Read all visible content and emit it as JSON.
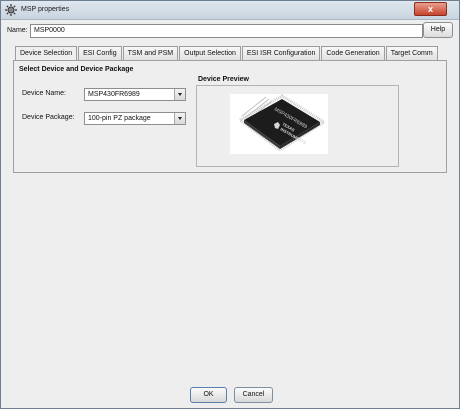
{
  "window": {
    "title": "MSP properties",
    "close_label": "x"
  },
  "name_row": {
    "label": "Name:",
    "value": "MSP0000",
    "help_label": "Help"
  },
  "tabs": [
    {
      "label": "Device Selection",
      "active": true
    },
    {
      "label": "ESI Config"
    },
    {
      "label": "TSM and PSM"
    },
    {
      "label": "Output Selection"
    },
    {
      "label": "ESI ISR Configuration"
    },
    {
      "label": "Code Generation"
    },
    {
      "label": "Target Comm"
    }
  ],
  "device_selection": {
    "section_title": "Select Device and Device Package",
    "device_name_label": "Device Name:",
    "device_name_value": "MSP430FR6989",
    "device_package_label": "Device Package:",
    "device_package_value": "100-pin PZ package",
    "preview_title": "Device Preview",
    "chip_marking": "MSP430FR6989",
    "chip_brand_line1": "TEXAS",
    "chip_brand_line2": "INSTRUMENTS"
  },
  "footer": {
    "ok_label": "OK",
    "cancel_label": "Cancel"
  },
  "colors": {
    "close_button": "#c7432a",
    "chip_body": "#1c1c1c",
    "pins": "#b8b8b8"
  }
}
